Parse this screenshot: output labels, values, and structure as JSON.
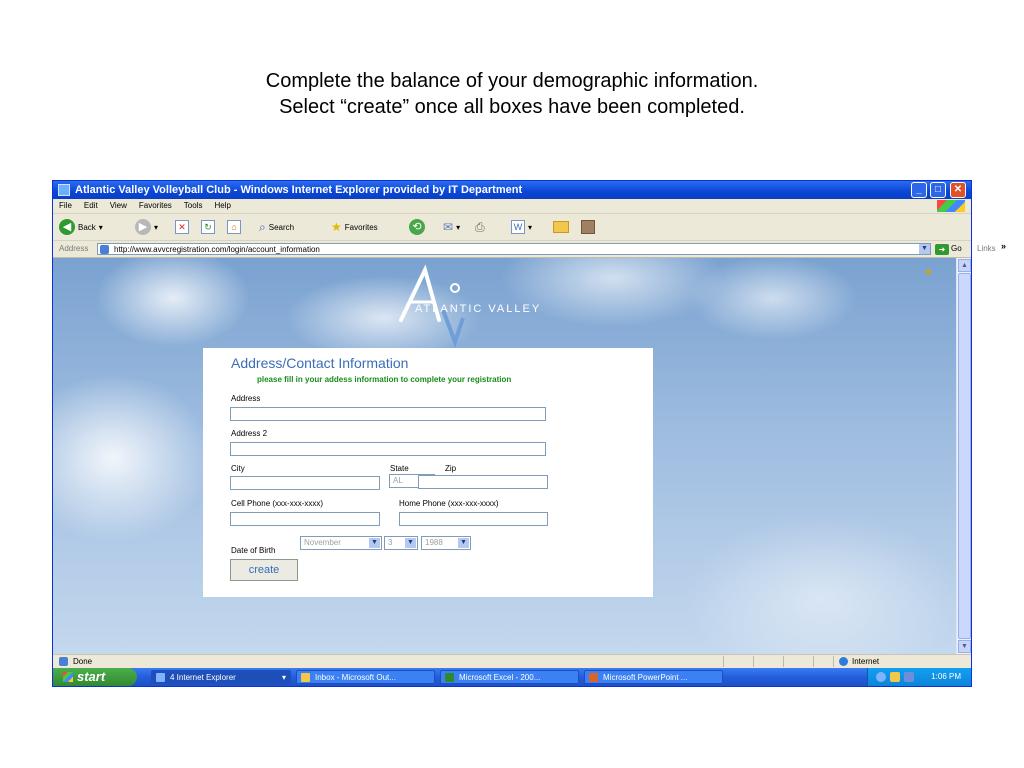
{
  "caption": {
    "line1": "Complete the balance of your demographic information.",
    "line2": "Select “create” once all boxes have been completed."
  },
  "window": {
    "title": "Atlantic Valley Volleyball Club - Windows Internet Explorer provided by IT Department",
    "controls": {
      "minimize": "_",
      "maximize": "□",
      "close": "✕"
    }
  },
  "menubar": [
    "File",
    "Edit",
    "View",
    "Favorites",
    "Tools",
    "Help"
  ],
  "toolbar": {
    "back": "Back",
    "search": "Search",
    "favorites": "Favorites"
  },
  "addressbar": {
    "label": "Address",
    "url": "http://www.avvcregistration.com/login/account_information",
    "go": "Go",
    "links": "Links",
    "more": "»"
  },
  "logo": {
    "text": "ATLANTIC VALLEY",
    "letter": "A"
  },
  "form": {
    "heading": "Address/Contact Information",
    "subheading": "please fill in your addess information to complete your registration",
    "address_label": "Address",
    "address_value": "",
    "address2_label": "Address 2",
    "address2_value": "",
    "city_label": "City",
    "city_value": "",
    "state_label": "State",
    "state_value": "AL",
    "zip_label": "Zip",
    "zip_value": "",
    "cell_label": "Cell Phone (xxx-xxx-xxxx)",
    "cell_value": "",
    "home_label": "Home Phone (xxx-xxx-xxxx)",
    "home_value": "",
    "dob_label": "Date of Birth",
    "dob_month": "November",
    "dob_day": "3",
    "dob_year": "1988",
    "create_label": "create"
  },
  "status": {
    "text": "Done",
    "zone": "Internet"
  },
  "taskbar": {
    "start": "start",
    "tasks": [
      "4 Internet Explorer",
      "Inbox - Microsoft Out...",
      "Microsoft Excel - 200...",
      "Microsoft PowerPoint ..."
    ],
    "clock": "1:06 PM"
  }
}
